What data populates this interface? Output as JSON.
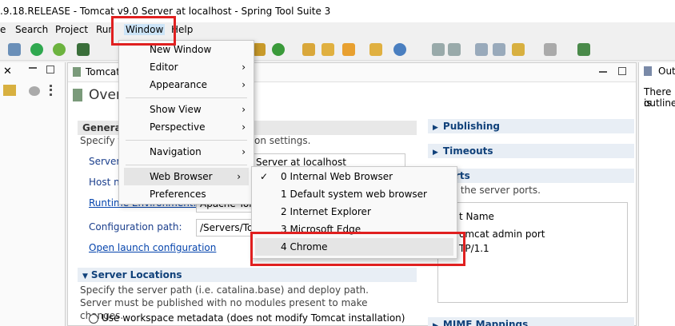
{
  "window": {
    "title": ".9.18.RELEASE - Tomcat v9.0 Server at localhost - Spring Tool Suite 3"
  },
  "menubar": {
    "items": [
      "e",
      "Search",
      "Project",
      "Run",
      "Window",
      "Help"
    ]
  },
  "left_panel": {
    "close": "✕"
  },
  "editor": {
    "tab_label": "Tomcat",
    "page_title": "Over",
    "general": {
      "header": "General",
      "desc_prefix": "Specify t",
      "desc_suffix": "on settings.",
      "server_label": "Server",
      "server_value": "Server at localhost",
      "host_label": "Host na",
      "runtime_label": "Runtime Environment:",
      "runtime_value": "Apache Tom",
      "config_label": "Configuration path:",
      "config_value": "/Servers/Tor",
      "open_launch": "Open launch configuration"
    },
    "server_locations": {
      "header": "Server Locations",
      "desc": "Specify the server path (i.e. catalina.base) and deploy path. Server must be published with no modules present to make changes.",
      "radio_workspace": "Use workspace metadata (does not modify Tomcat installation)"
    },
    "right_column": {
      "publishing": "Publishing",
      "timeouts": "Timeouts",
      "ports_header": "rts",
      "ports_desc": "y the server ports.",
      "port_name_col": "t Name",
      "port_row1": "omcat admin port",
      "port_row2": "TP/1.1",
      "mime": "MIME Mappings"
    }
  },
  "outline": {
    "tab": "Out",
    "text_line1": "There is",
    "text_line2": "outline."
  },
  "window_menu": {
    "items": [
      {
        "label": "New Window",
        "submenu": false
      },
      {
        "label": "Editor",
        "submenu": true
      },
      {
        "label": "Appearance",
        "submenu": true
      },
      {
        "label": "Show View",
        "submenu": true
      },
      {
        "label": "Perspective",
        "submenu": true
      },
      {
        "label": "Navigation",
        "submenu": true
      },
      {
        "label": "Web Browser",
        "submenu": true
      },
      {
        "label": "Preferences",
        "submenu": false
      }
    ]
  },
  "browser_submenu": {
    "items": [
      {
        "label": "0 Internal Web Browser",
        "checked": true
      },
      {
        "label": "1 Default system web browser",
        "checked": false
      },
      {
        "label": "2 Internet Explorer",
        "checked": false
      },
      {
        "label": "3 Microsoft Edge",
        "checked": false
      },
      {
        "label": "4 Chrome",
        "checked": false
      }
    ],
    "check": "✓"
  },
  "colors": {
    "highlight": "#e02020",
    "link": "#0645ad",
    "section": "#10417a"
  }
}
